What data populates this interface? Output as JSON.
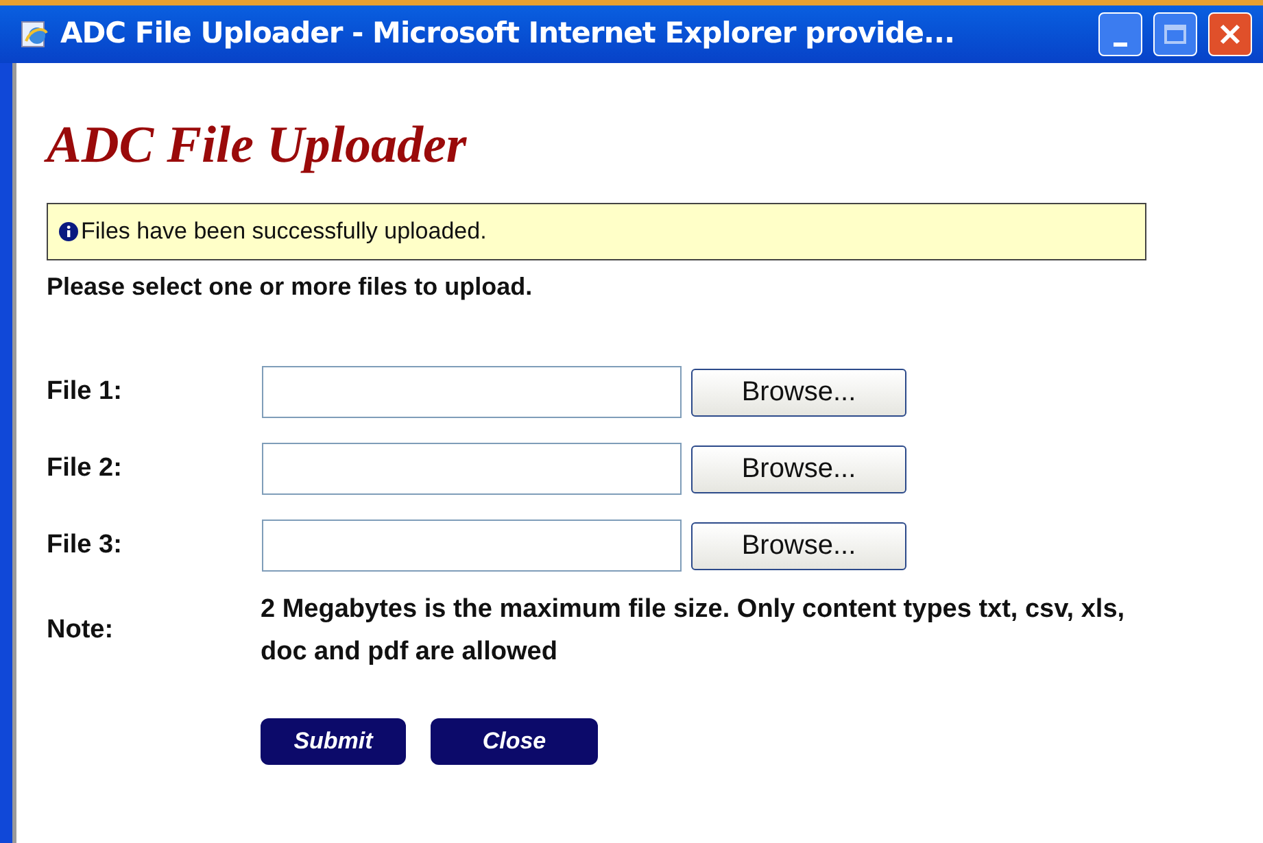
{
  "window": {
    "title": "ADC File Uploader - Microsoft Internet Explorer provide..."
  },
  "heading": "ADC File Uploader",
  "message": "Files have been successfully uploaded.",
  "instruction": "Please select one or more files to upload.",
  "files": [
    {
      "label": "File 1:",
      "button": "Browse..."
    },
    {
      "label": "File 2:",
      "button": "Browse..."
    },
    {
      "label": "File 3:",
      "button": "Browse..."
    }
  ],
  "note": {
    "label": "Note:",
    "text": "2 Megabytes is the maximum file size. Only content types txt, csv, xls, doc and pdf are allowed"
  },
  "buttons": [
    "Submit",
    "Close"
  ]
}
